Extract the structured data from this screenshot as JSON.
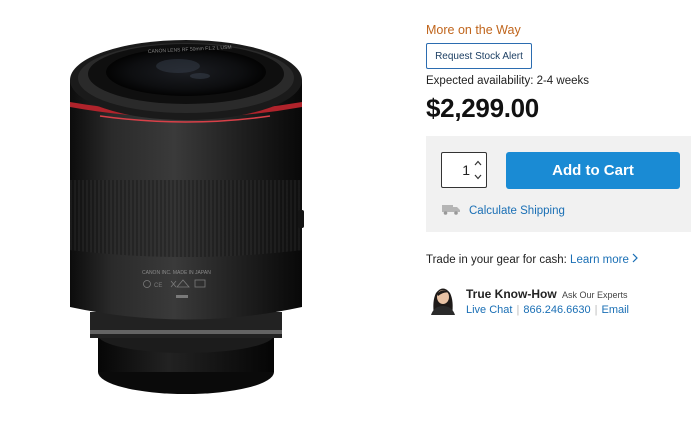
{
  "product": {
    "image_alt": "Canon RF 50mm lens",
    "lens_text_top": "CANON LENS RF 50mm F1.2 L USM",
    "lens_text_body": "CANON INC.   MADE IN JAPAN"
  },
  "buybox": {
    "stock_status": "More on the Way",
    "stock_alert_label": "Request Stock Alert",
    "availability": "Expected availability: 2-4 weeks",
    "price": "$2,299.00",
    "quantity": "1",
    "add_to_cart_label": "Add to Cart",
    "shipping_label": "Calculate Shipping",
    "trade_in_text": "Trade in your gear for cash:",
    "learn_more_label": "Learn more",
    "expert_title": "True Know-How",
    "expert_subtitle": "Ask Our Experts",
    "live_chat_label": "Live Chat",
    "phone": "866.246.6630",
    "email_label": "Email"
  },
  "colors": {
    "accent_orange": "#c0651c",
    "cart_blue": "#1a8bd4",
    "link_blue": "#1a6fb5",
    "panel_gray": "#f1f1f1"
  },
  "icons": [
    "truck-icon",
    "chevron-right-icon",
    "chevron-up-icon",
    "chevron-down-icon",
    "expert-avatar-icon"
  ]
}
